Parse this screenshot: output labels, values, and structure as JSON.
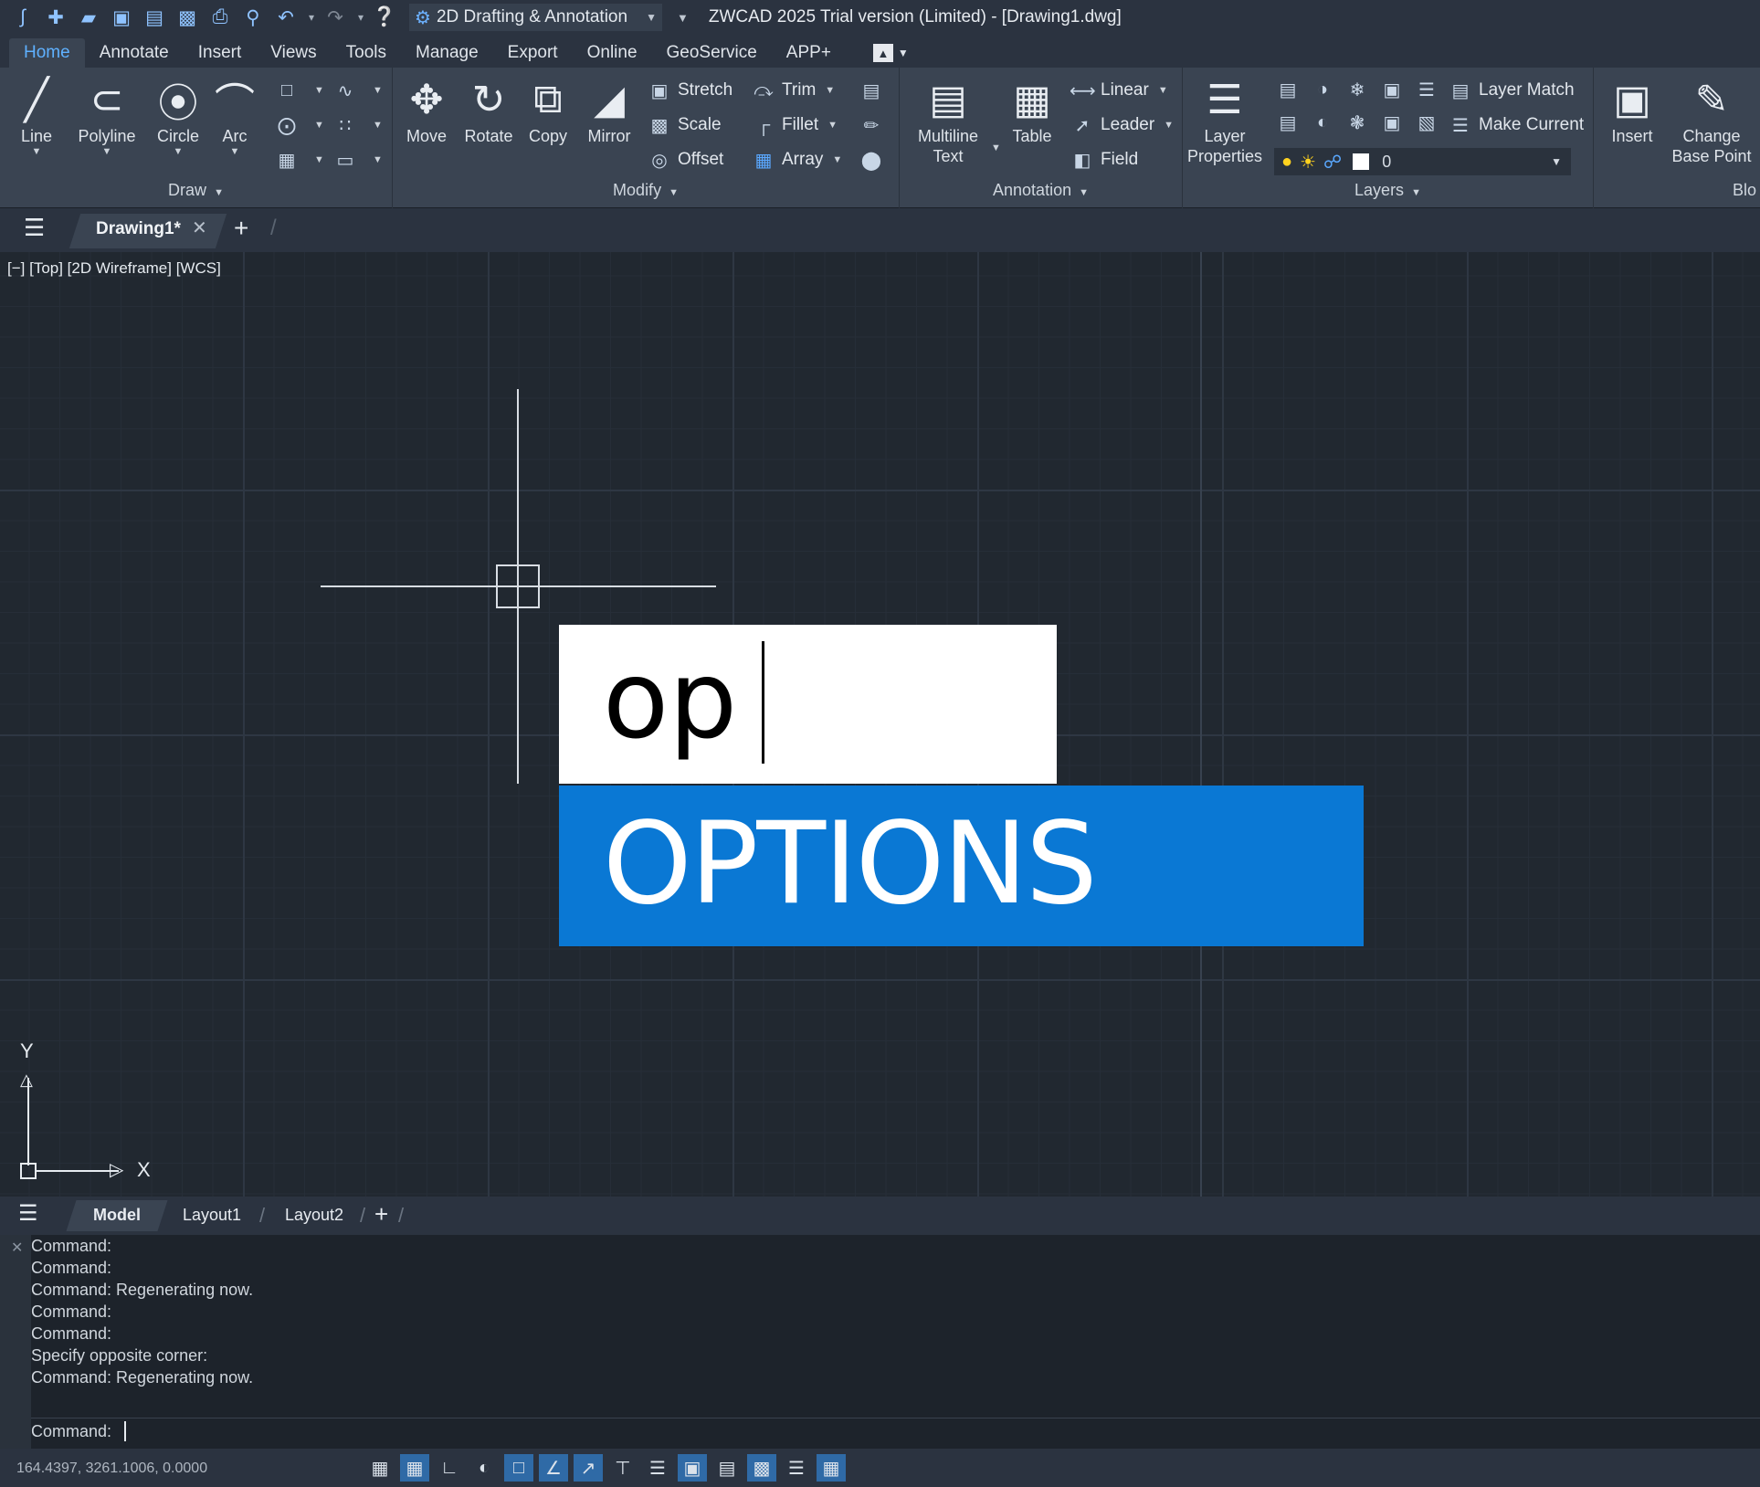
{
  "title_bar": {
    "workspace": "2D Drafting & Annotation",
    "window_title": "ZWCAD 2025 Trial version (Limited) - [Drawing1.dwg]",
    "quick_access_icons": [
      "app-logo-icon",
      "new-icon",
      "open-icon",
      "save-icon",
      "save-as-icon",
      "publish-icon",
      "print-icon",
      "print-preview-icon",
      "undo-icon",
      "redo-icon",
      "help-icon"
    ]
  },
  "menu": {
    "tabs": [
      "Home",
      "Annotate",
      "Insert",
      "Views",
      "Tools",
      "Manage",
      "Export",
      "Online",
      "GeoService",
      "APP+"
    ],
    "active": "Home"
  },
  "ribbon": {
    "draw": {
      "title": "Draw",
      "line": "Line",
      "polyline": "Polyline",
      "circle": "Circle",
      "arc": "Arc"
    },
    "modify": {
      "title": "Modify",
      "move": "Move",
      "rotate": "Rotate",
      "copy": "Copy",
      "mirror": "Mirror",
      "stretch": "Stretch",
      "scale": "Scale",
      "offset": "Offset",
      "trim": "Trim",
      "fillet": "Fillet",
      "array": "Array"
    },
    "annotation": {
      "title": "Annotation",
      "multiline_text": "Multiline\nText",
      "table": "Table",
      "linear": "Linear",
      "leader": "Leader",
      "field": "Field"
    },
    "layers": {
      "title": "Layers",
      "layer_properties": "Layer\nProperties",
      "layer_match": "Layer Match",
      "make_current": "Make Current",
      "current_layer": "0"
    },
    "block": {
      "title": "Blo",
      "insert": "Insert",
      "change_base_point": "Change\nBase Point"
    }
  },
  "document_tabs": {
    "active": "Drawing1*"
  },
  "viewport": {
    "label": "[−] [Top] [2D Wireframe] [WCS]",
    "command_input": "op",
    "suggestion": "OPTIONS",
    "ucs_x": "X",
    "ucs_y": "Y"
  },
  "layout_tabs": [
    "Model",
    "Layout1",
    "Layout2"
  ],
  "command_history": [
    "Command:",
    "Command:",
    "Command: Regenerating now.",
    "Command:",
    "Command:",
    "Specify opposite corner:",
    "Command: Regenerating now."
  ],
  "command_prompt": "Command:",
  "status": {
    "coordinates": "164.4397, 3261.1006, 0.0000"
  },
  "colors": {
    "accent_blue": "#0a78d4",
    "canvas_bg": "#212830",
    "ribbon_bg": "#3a4452"
  }
}
